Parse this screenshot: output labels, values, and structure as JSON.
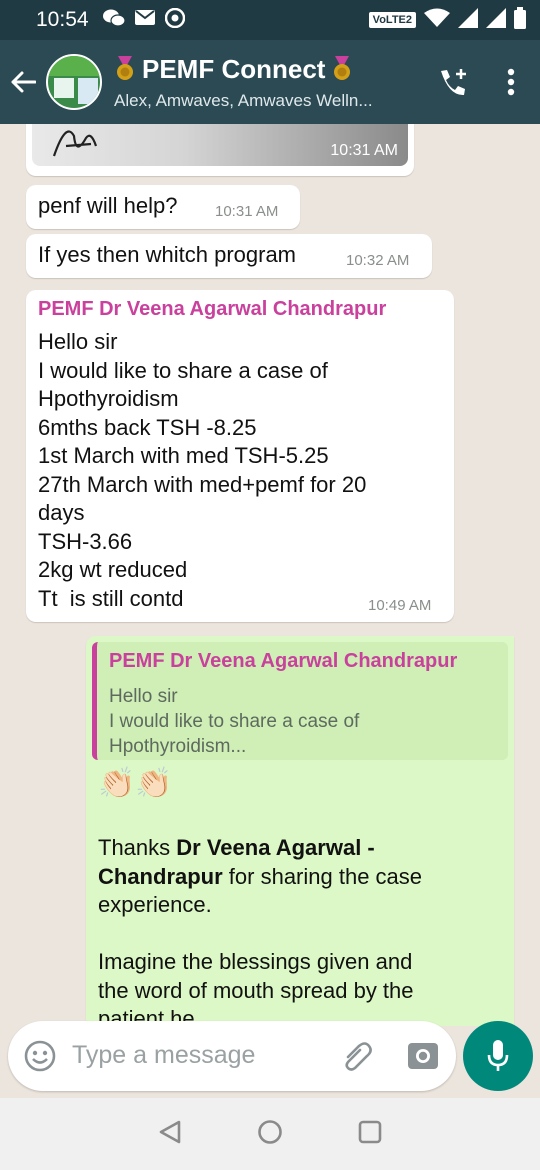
{
  "status": {
    "time": "10:54",
    "volte": "VoLTE2"
  },
  "header": {
    "title": "PEMF Connect",
    "subtitle": "Alex, Amwaves, Amwaves Welln..."
  },
  "messages": {
    "image_ts": "10:31 AM",
    "m1": {
      "text": "penf will help?",
      "ts": "10:31 AM"
    },
    "m2": {
      "text": "If yes then whitch program",
      "ts": "10:32 AM"
    },
    "m3": {
      "sender": "PEMF Dr Veena Agarwal Chandrapur",
      "lines": [
        "Hello sir",
        "I would like to share a case of",
        "Hpothyroidism",
        "6mths back TSH -8.25",
        "1st March with med TSH-5.25",
        "27th March with med+pemf for 20",
        "days",
        "TSH-3.66",
        "2kg wt reduced",
        "Tt  is still contd"
      ],
      "ts": "10:49 AM"
    },
    "m4": {
      "quote_sender": "PEMF Dr Veena Agarwal Chandrapur",
      "quote_lines": [
        "Hello sir",
        "I would like to share a case of",
        "Hpothyroidism..."
      ],
      "emoji": "👏🏻👏🏻",
      "thanks_pre": "Thanks ",
      "thanks_bold1": "Dr Veena Agarwal -",
      "thanks_bold2": "Chandrapur",
      "thanks_post": " for sharing the case",
      "thanks_line3": "experience.",
      "imagine_1": "Imagine the blessings given and",
      "imagine_2": "the word of mouth spread by the",
      "imagine_3": "patient he..."
    }
  },
  "composer": {
    "placeholder": "Type a message"
  },
  "colors": {
    "header": "#2b4a54",
    "statusbar": "#203a43",
    "out_bubble": "#dcf8c6",
    "sender": "#c9419c",
    "mic": "#00897b"
  }
}
